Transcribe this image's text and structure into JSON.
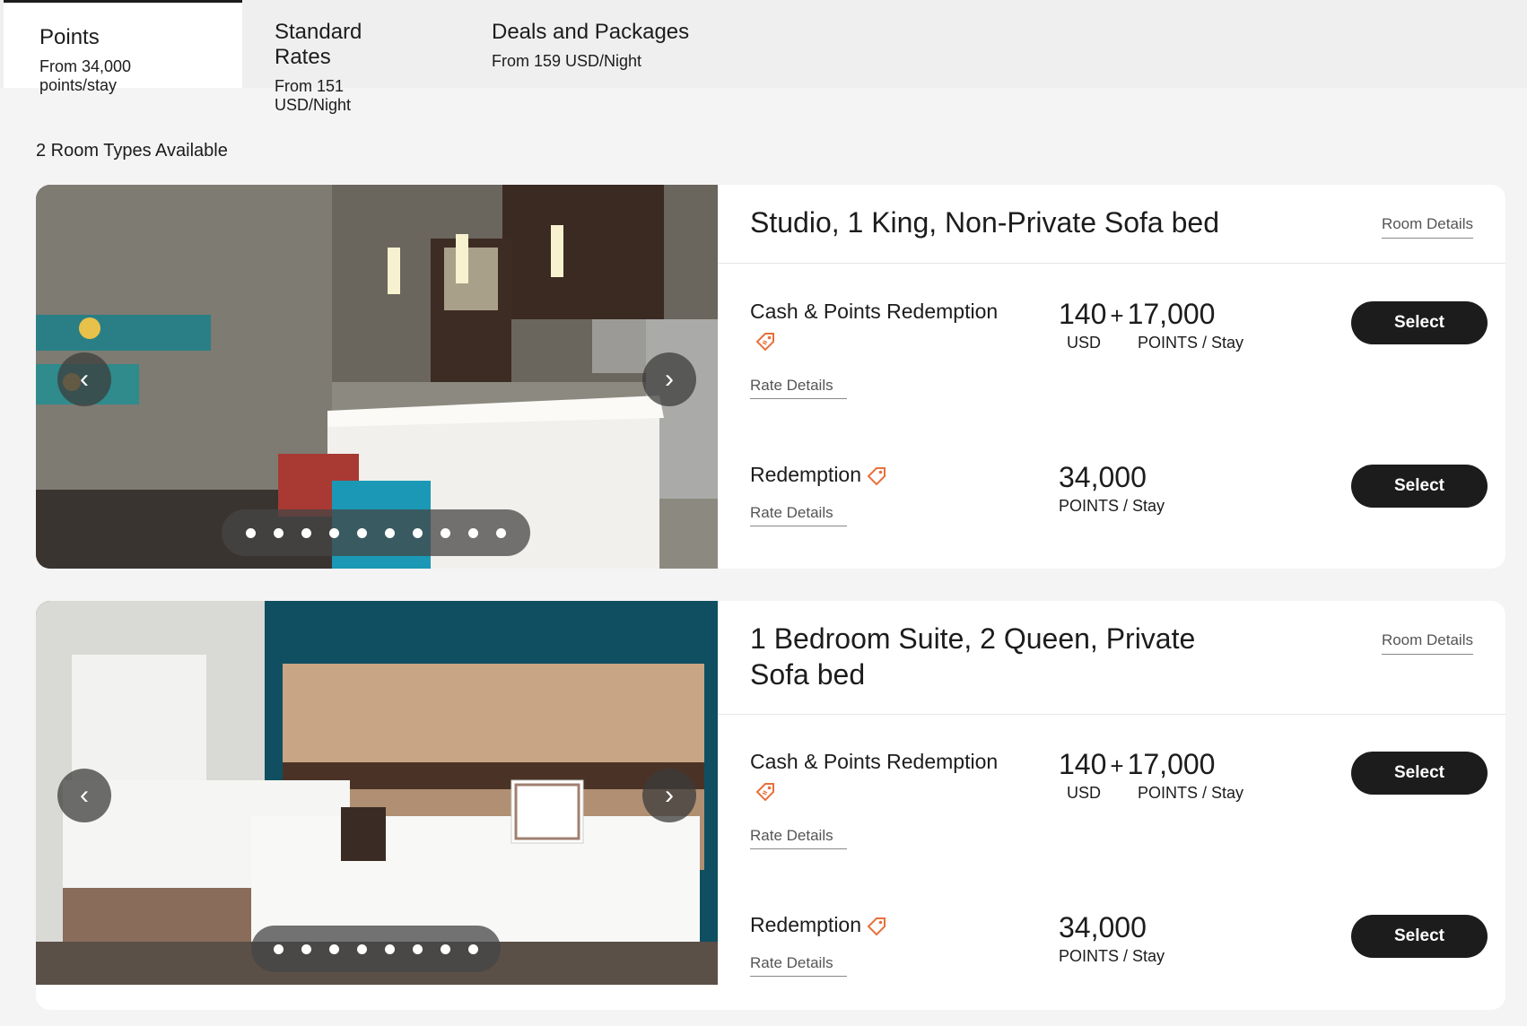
{
  "tabs": [
    {
      "title": "Points",
      "subtitle": "From 34,000 points/stay"
    },
    {
      "title": "Standard Rates",
      "subtitle": "From 151 USD/Night"
    },
    {
      "title": "Deals and Packages",
      "subtitle": "From 159 USD/Night"
    }
  ],
  "room_count_label": "2 Room Types Available",
  "rooms": [
    {
      "title": "Studio, 1 King, Non-Private Sofa bed",
      "room_details_label": "Room Details",
      "carousel": {
        "prev_icon": "chevron-left-icon",
        "next_icon": "chevron-right-icon",
        "dot_count": 10
      },
      "rates": [
        {
          "name": "Cash & Points Redemption",
          "rate_details_label": "Rate Details",
          "cash_amount": "140",
          "plus": "+",
          "points_amount": "17,000",
          "cash_unit": "USD",
          "points_unit": "POINTS / Stay",
          "select_label": "Select"
        },
        {
          "name": "Redemption",
          "rate_details_label": "Rate Details",
          "points_amount": "34,000",
          "points_unit": "POINTS / Stay",
          "select_label": "Select"
        }
      ]
    },
    {
      "title": "1 Bedroom Suite, 2 Queen, Private Sofa bed",
      "room_details_label": "Room Details",
      "carousel": {
        "prev_icon": "chevron-left-icon",
        "next_icon": "chevron-right-icon",
        "dot_count": 8
      },
      "rates": [
        {
          "name": "Cash & Points Redemption",
          "rate_details_label": "Rate Details",
          "cash_amount": "140",
          "plus": "+",
          "points_amount": "17,000",
          "cash_unit": "USD",
          "points_unit": "POINTS / Stay",
          "select_label": "Select"
        },
        {
          "name": "Redemption",
          "rate_details_label": "Rate Details",
          "points_amount": "34,000",
          "points_unit": "POINTS / Stay",
          "select_label": "Select"
        }
      ]
    }
  ],
  "colors": {
    "accent_tag": "#e8703a",
    "button_bg": "#1c1c1c",
    "page_bg": "#f4f4f4"
  }
}
